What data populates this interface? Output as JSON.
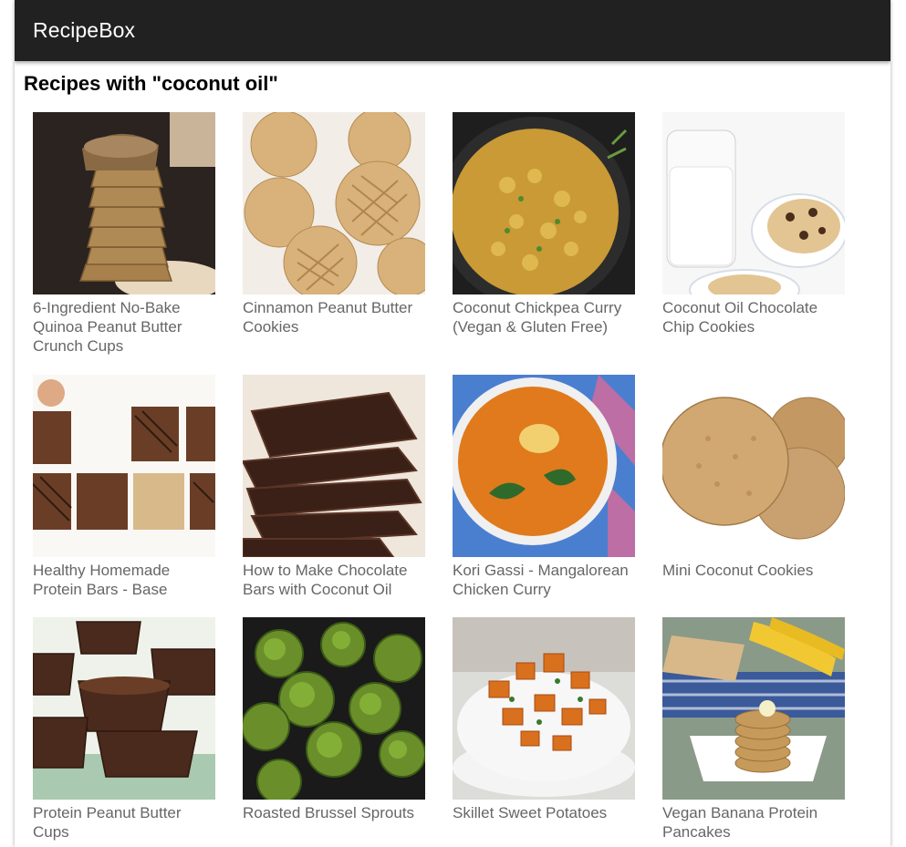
{
  "app": {
    "brand": "RecipeBox"
  },
  "search": {
    "heading": "Recipes with \"coconut oil\""
  },
  "recipes": [
    {
      "title": "6-Ingredient No-Bake Quinoa Peanut Butter Crunch Cups",
      "image": "quinoa-peanut-butter-cups-photo"
    },
    {
      "title": "Cinnamon Peanut Butter Cookies",
      "image": "peanut-butter-cookies-photo"
    },
    {
      "title": "Coconut Chickpea Curry (Vegan & Gluten Free)",
      "image": "chickpea-curry-photo"
    },
    {
      "title": "Coconut Oil Chocolate Chip Cookies",
      "image": "chocolate-chip-cookies-milk-photo"
    },
    {
      "title": "Healthy Homemade Protein Bars - Base",
      "image": "protein-bars-photo"
    },
    {
      "title": "How to Make Chocolate Bars with Coconut Oil",
      "image": "chocolate-bars-photo"
    },
    {
      "title": "Kori Gassi - Mangalorean Chicken Curry",
      "image": "chicken-curry-bowl-photo"
    },
    {
      "title": "Mini Coconut Cookies",
      "image": "coconut-cookies-photo"
    },
    {
      "title": "Protein Peanut Butter Cups",
      "image": "peanut-butter-cups-photo"
    },
    {
      "title": "Roasted Brussel Sprouts",
      "image": "brussel-sprouts-photo"
    },
    {
      "title": "Skillet Sweet Potatoes",
      "image": "sweet-potatoes-photo"
    },
    {
      "title": "Vegan Banana Protein Pancakes",
      "image": "banana-pancakes-photo"
    }
  ]
}
